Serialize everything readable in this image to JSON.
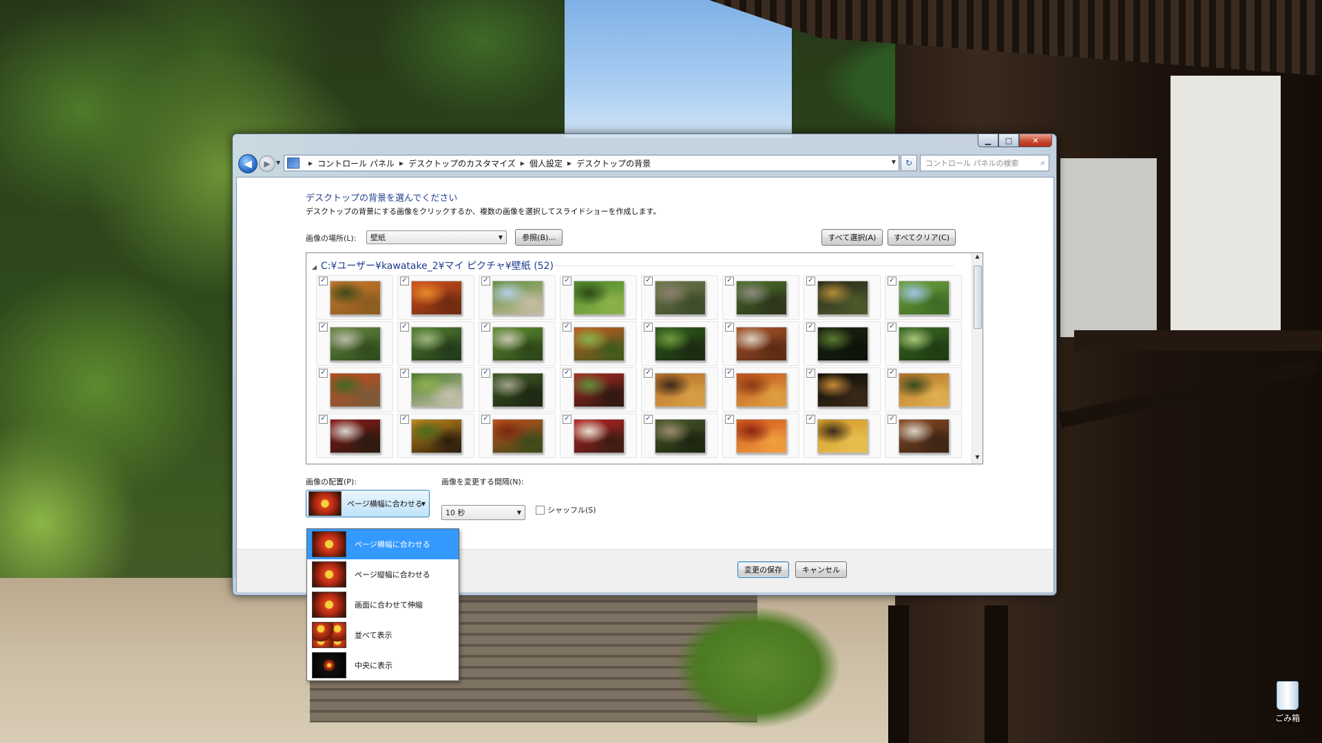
{
  "desktop": {
    "recycle_bin_label": "ごみ箱"
  },
  "window": {
    "caption_buttons": {
      "minimize": "▁",
      "maximize": "□",
      "close": "✕"
    }
  },
  "nav": {
    "back": "◀",
    "forward": "▶",
    "breadcrumb": [
      "コントロール パネル",
      "デスクトップのカスタマイズ",
      "個人設定",
      "デスクトップの背景"
    ],
    "search_placeholder": "コントロール パネルの検索"
  },
  "page": {
    "heading": "デスクトップの背景を選んでください",
    "subheading": "デスクトップの背景にする画像をクリックするか、複数の画像を選択してスライドショーを作成します。",
    "location_label": "画像の場所(L):",
    "location_value": "壁紙",
    "browse_button": "参照(B)...",
    "select_all_button": "すべて選択(A)",
    "clear_all_button": "すべてクリア(C)"
  },
  "gallery": {
    "group_title": "C:¥ユーザー¥kawatake_2¥マイ ピクチャ¥壁紙 (52)",
    "thumbnails": [
      {
        "checked": true,
        "palette": [
          "#c9792a",
          "#3d4a1a",
          "#8a5b20"
        ]
      },
      {
        "checked": true,
        "palette": [
          "#d24e1c",
          "#e58a2a",
          "#6b2a10"
        ]
      },
      {
        "checked": true,
        "palette": [
          "#5f8f38",
          "#b8cfe6",
          "#c7bca3"
        ]
      },
      {
        "checked": true,
        "palette": [
          "#4f8a2a",
          "#2c4a16",
          "#8fb24a"
        ]
      },
      {
        "checked": true,
        "palette": [
          "#6f7a4a",
          "#8a7f6f",
          "#3d4a2a"
        ]
      },
      {
        "checked": true,
        "palette": [
          "#4c6e2c",
          "#8a8a80",
          "#2b3318"
        ]
      },
      {
        "checked": true,
        "palette": [
          "#2a2a1c",
          "#b38b3a",
          "#4d5a2a"
        ]
      },
      {
        "checked": true,
        "palette": [
          "#6fa13a",
          "#9ec4e8",
          "#3c6a24"
        ]
      },
      {
        "checked": true,
        "palette": [
          "#6a8a44",
          "#b7b7a6",
          "#2f4a1c"
        ]
      },
      {
        "checked": true,
        "palette": [
          "#4f7f2f",
          "#9fb27c",
          "#23381a"
        ]
      },
      {
        "checked": true,
        "palette": [
          "#5f8f30",
          "#c9c4b2",
          "#2b4418"
        ]
      },
      {
        "checked": true,
        "palette": [
          "#c25a22",
          "#8ab24a",
          "#3d5a1c"
        ]
      },
      {
        "checked": true,
        "palette": [
          "#2f5a1c",
          "#6f9a3a",
          "#1a2a10"
        ]
      },
      {
        "checked": true,
        "palette": [
          "#a8542a",
          "#d8d1c0",
          "#5a2a14"
        ]
      },
      {
        "checked": true,
        "palette": [
          "#1c2410",
          "#5a7a30",
          "#0c120a"
        ]
      },
      {
        "checked": true,
        "palette": [
          "#3a6a24",
          "#a9c67a",
          "#1f3a12"
        ]
      },
      {
        "checked": true,
        "palette": [
          "#c24a1c",
          "#3d6a24",
          "#7a5a3a"
        ]
      },
      {
        "checked": true,
        "palette": [
          "#4a7a2a",
          "#8fb050",
          "#c6c1ad"
        ]
      },
      {
        "checked": true,
        "palette": [
          "#3d5a24",
          "#9f9f8c",
          "#1c2612"
        ]
      },
      {
        "checked": true,
        "palette": [
          "#a82a24",
          "#5f8f38",
          "#2b1810"
        ]
      },
      {
        "checked": true,
        "palette": [
          "#b8702a",
          "#3a2a18",
          "#d9a046"
        ]
      },
      {
        "checked": true,
        "palette": [
          "#c2561c",
          "#8a3a14",
          "#e0a040"
        ]
      },
      {
        "checked": true,
        "palette": [
          "#0c0c08",
          "#c88a3a",
          "#3a2a18"
        ]
      },
      {
        "checked": true,
        "palette": [
          "#b8762a",
          "#3a4a1c",
          "#e0b050"
        ]
      },
      {
        "checked": true,
        "palette": [
          "#8a1818",
          "#d8d8cf",
          "#2a1a10"
        ]
      },
      {
        "checked": true,
        "palette": [
          "#c88a1c",
          "#4a6a1c",
          "#2a1c0c"
        ]
      },
      {
        "checked": true,
        "palette": [
          "#c2501c",
          "#7a2a10",
          "#3a4a1a"
        ]
      },
      {
        "checked": true,
        "palette": [
          "#b82424",
          "#e8e0d0",
          "#3a1c14"
        ]
      },
      {
        "checked": true,
        "palette": [
          "#4a5a2a",
          "#9a8a70",
          "#1c2410"
        ]
      },
      {
        "checked": true,
        "palette": [
          "#d2561c",
          "#8a2410",
          "#f0a040"
        ]
      },
      {
        "checked": true,
        "palette": [
          "#d49a2a",
          "#3a2a18",
          "#e8c050"
        ]
      },
      {
        "checked": true,
        "palette": [
          "#8a4a24",
          "#d7d2c4",
          "#3a2414"
        ]
      }
    ]
  },
  "position": {
    "label": "画像の配置(P):",
    "selected": "ページ横幅に合わせる",
    "options": [
      {
        "label": "ページ横幅に合わせる",
        "icon": "fill-icon",
        "selected": true
      },
      {
        "label": "ページ縦幅に合わせる",
        "icon": "fit-icon",
        "selected": false
      },
      {
        "label": "画面に合わせて伸縮",
        "icon": "stretch-icon",
        "selected": false
      },
      {
        "label": "並べて表示",
        "icon": "tile-icon",
        "selected": false
      },
      {
        "label": "中央に表示",
        "icon": "center-icon",
        "selected": false
      }
    ]
  },
  "interval": {
    "label": "画像を変更する間隔(N):",
    "value": "10 秒",
    "shuffle_label": "シャッフル(S)",
    "shuffle_checked": false
  },
  "footer": {
    "save_button": "変更の保存",
    "cancel_button": "キャンセル"
  }
}
